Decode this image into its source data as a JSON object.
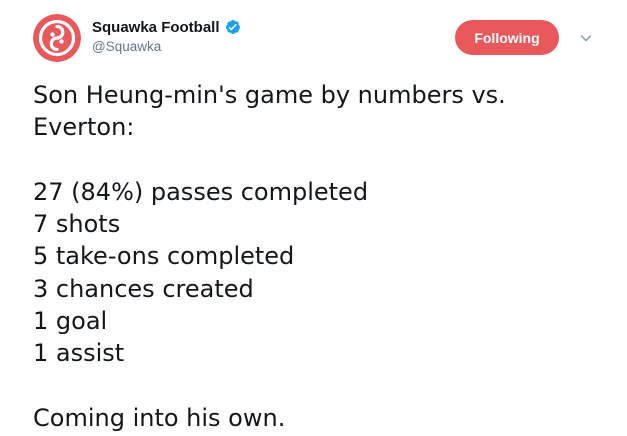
{
  "tweet": {
    "author": {
      "display_name": "Squawka Football",
      "handle": "@Squawka",
      "verified": true,
      "avatar_icon": "squawka-logo-icon",
      "avatar_color": "#e9595c"
    },
    "follow_button": {
      "label": "Following",
      "color": "#e9595c"
    },
    "menu_icon": "chevron-down-icon",
    "verified_icon": "verified-badge-icon",
    "verified_color": "#1da1f2",
    "text_lines": [
      "Son Heung-min's game by numbers vs.",
      "Everton:",
      "",
      "27 (84%) passes completed",
      "7 shots",
      "5 take-ons completed",
      "3 chances created",
      "1 goal",
      "1 assist",
      "",
      "Coming into his own."
    ]
  }
}
